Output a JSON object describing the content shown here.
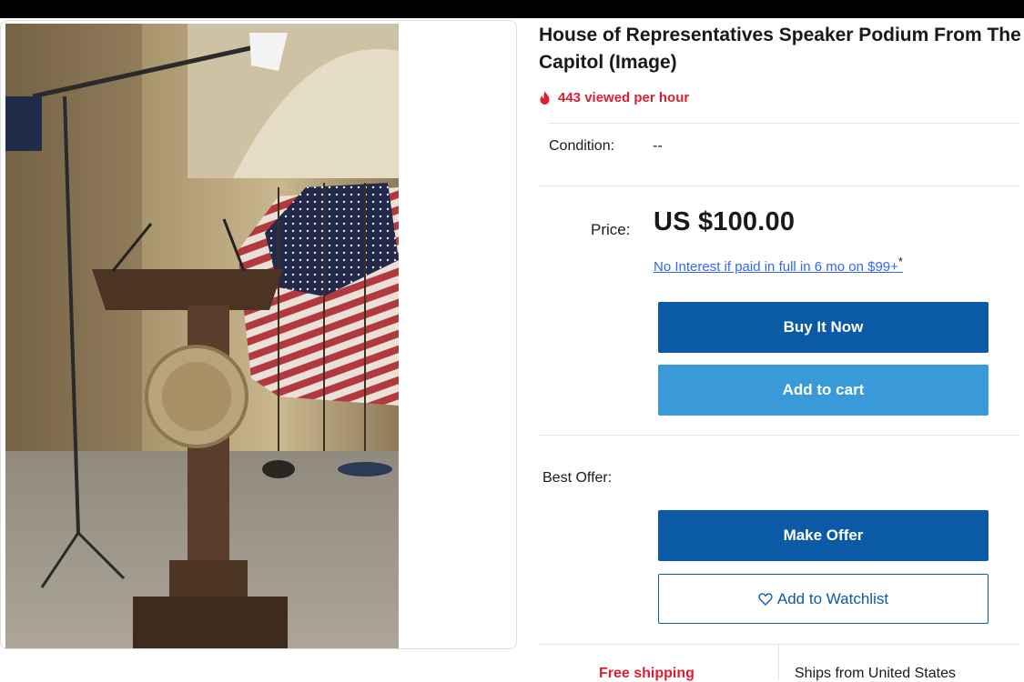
{
  "listing": {
    "title": "House of Representatives Speaker Podium From The Capitol (Image)",
    "views_text": "443 viewed per hour",
    "condition_label": "Condition:",
    "condition_value": "--",
    "price_label": "Price:",
    "price_value": "US $100.00",
    "financing_text": "No Interest if paid in full in 6 mo on $99+",
    "financing_asterisk": "*",
    "best_offer_label": "Best Offer:"
  },
  "actions": {
    "buy_now": "Buy It Now",
    "add_to_cart": "Add to cart",
    "make_offer": "Make Offer",
    "watchlist": "Add to Watchlist"
  },
  "shipping": {
    "free_shipping": "Free shipping",
    "ships_from": "Ships from United States"
  },
  "icons": {
    "views": "fire-icon",
    "watchlist": "heart-icon"
  },
  "colors": {
    "primary_button": "#0b5aa6",
    "secondary_button": "#3a9ad9",
    "alert_red": "#dd1e31",
    "link_blue": "#3665f3"
  }
}
